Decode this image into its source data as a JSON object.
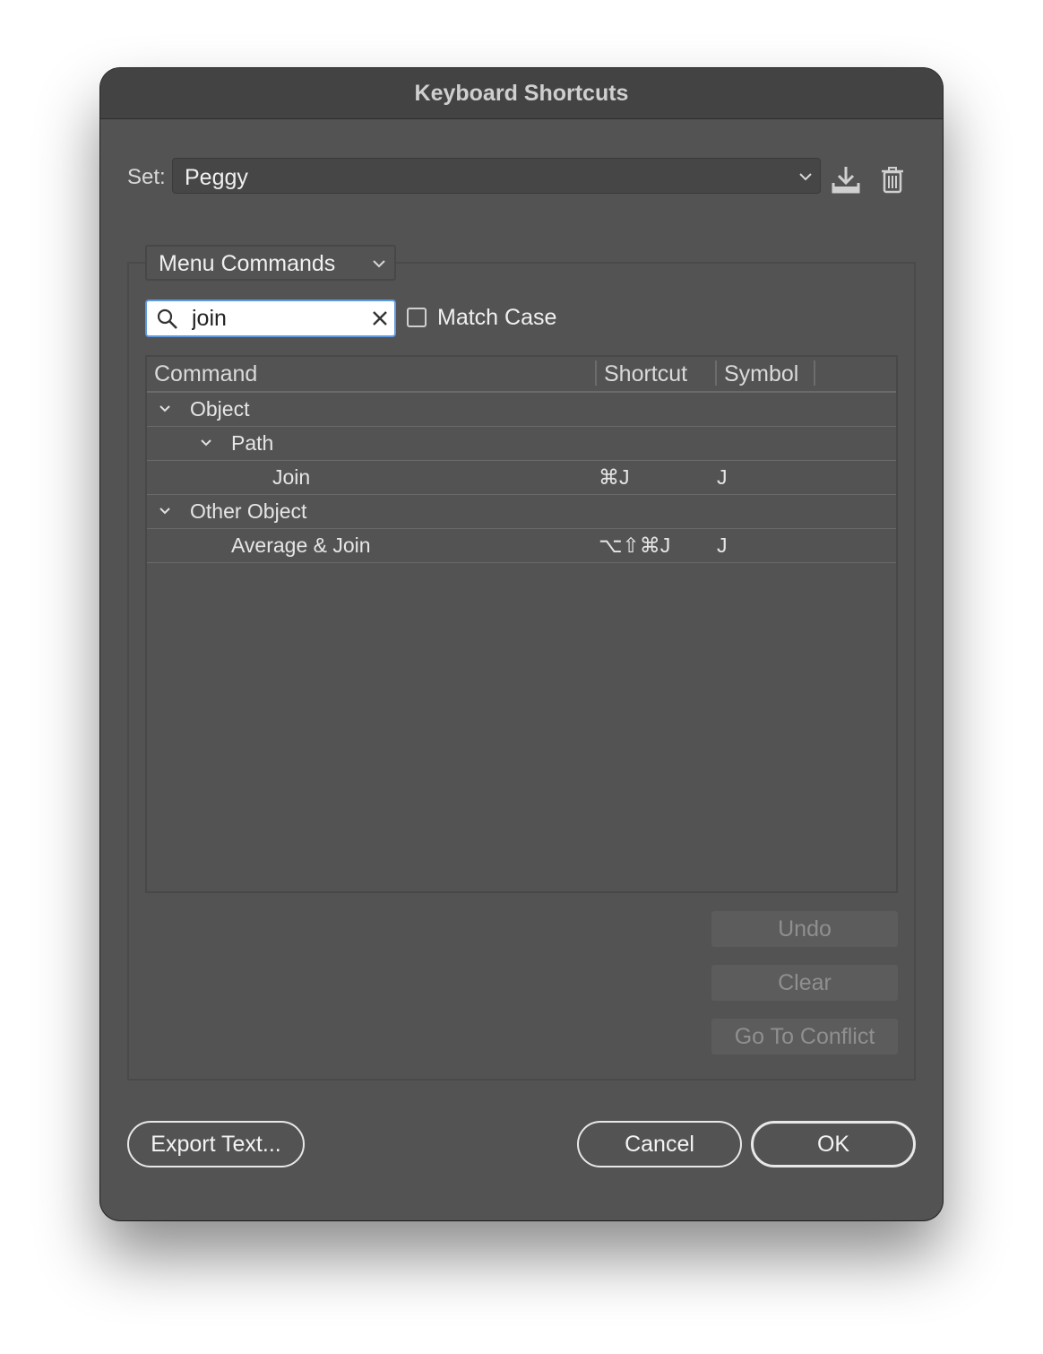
{
  "dialog": {
    "title": "Keyboard Shortcuts"
  },
  "set": {
    "label": "Set:",
    "value": "Peggy"
  },
  "mode": {
    "value": "Menu Commands"
  },
  "search": {
    "value": "join",
    "match_case_label": "Match Case",
    "match_case_checked": false
  },
  "table": {
    "columns": [
      "Command",
      "Shortcut",
      "Symbol"
    ],
    "rows": [
      {
        "command": "Object",
        "shortcut": "",
        "symbol": "",
        "level": 0,
        "expandable": true
      },
      {
        "command": "Path",
        "shortcut": "",
        "symbol": "",
        "level": 1,
        "expandable": true
      },
      {
        "command": "Join",
        "shortcut": "⌘J",
        "symbol": "J",
        "level": 2,
        "expandable": false
      },
      {
        "command": "Other Object",
        "shortcut": "",
        "symbol": "",
        "level": 0,
        "expandable": true
      },
      {
        "command": "Average & Join",
        "shortcut": "⌥⇧⌘J",
        "symbol": "J",
        "level": 1,
        "expandable": false
      }
    ]
  },
  "side_buttons": {
    "undo": "Undo",
    "clear": "Clear",
    "go_to_conflict": "Go To Conflict"
  },
  "footer": {
    "export": "Export Text...",
    "cancel": "Cancel",
    "ok": "OK"
  },
  "icons": {
    "save": "save-set-icon",
    "delete": "trash-icon",
    "search": "search-icon",
    "clear": "clear-search-icon"
  },
  "colors": {
    "dialog_bg": "#535353",
    "titlebar_bg": "#434343",
    "focus_ring": "#5e9be0"
  }
}
